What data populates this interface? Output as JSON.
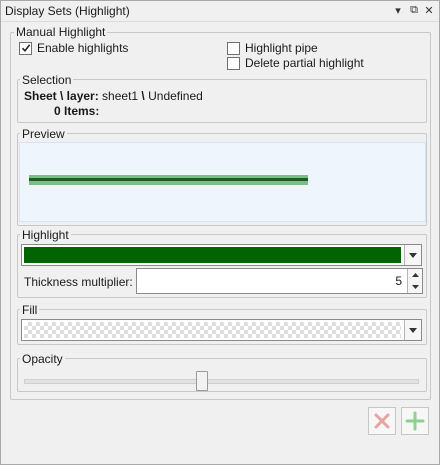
{
  "window": {
    "title": "Display Sets (Highlight)",
    "menu_glyph": "▾",
    "restore_glyph": "⧉",
    "close_glyph": "✕"
  },
  "manual": {
    "legend": "Manual Highlight",
    "enable_label": "Enable highlights",
    "enable_checked": true,
    "pipe_label": "Highlight pipe",
    "pipe_checked": false,
    "delete_label": "Delete partial highlight",
    "delete_checked": false
  },
  "selection": {
    "legend": "Selection",
    "sheet_label": "Sheet \\ layer:",
    "sheet_value_a": "sheet1",
    "separator": "\\",
    "sheet_value_b": "Undefined",
    "items_label": "0 Items:"
  },
  "preview": {
    "legend": "Preview",
    "line_color": "#1f5a2a",
    "halo_color": "#7bbf83"
  },
  "highlight": {
    "legend": "Highlight",
    "color": "#006400",
    "thickness_label": "Thickness multiplier:",
    "thickness_value": "5"
  },
  "fill": {
    "legend": "Fill"
  },
  "opacity": {
    "legend": "Opacity",
    "level": 0.45
  },
  "actions": {
    "delete_color": "#e8a3a3",
    "add_color": "#8fd28f"
  }
}
